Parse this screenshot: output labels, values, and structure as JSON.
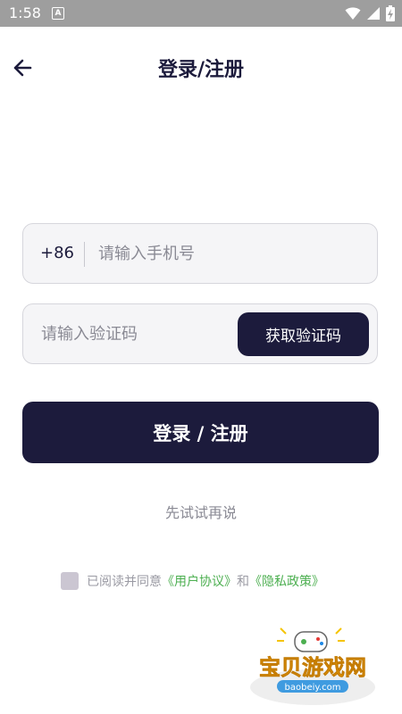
{
  "status_bar": {
    "time": "1:58",
    "notification_badge": "A"
  },
  "header": {
    "title": "登录/注册"
  },
  "phone": {
    "country_code": "+86",
    "placeholder": "请输入手机号"
  },
  "code": {
    "placeholder": "请输入验证码",
    "get_code_label": "获取验证码"
  },
  "login": {
    "label": "登录 / 注册"
  },
  "skip": {
    "label": "先试试再说"
  },
  "agreement": {
    "prefix": "已阅读并同意",
    "user_agreement": "《用户协议》",
    "conjunction": "和",
    "privacy_policy": "《隐私政策》"
  },
  "watermark": {
    "brand": "宝贝游戏网",
    "url": "baobeiy.com"
  },
  "colors": {
    "primary": "#1c1b3c",
    "link": "#4caf50",
    "field_bg": "#f5f5f7"
  }
}
